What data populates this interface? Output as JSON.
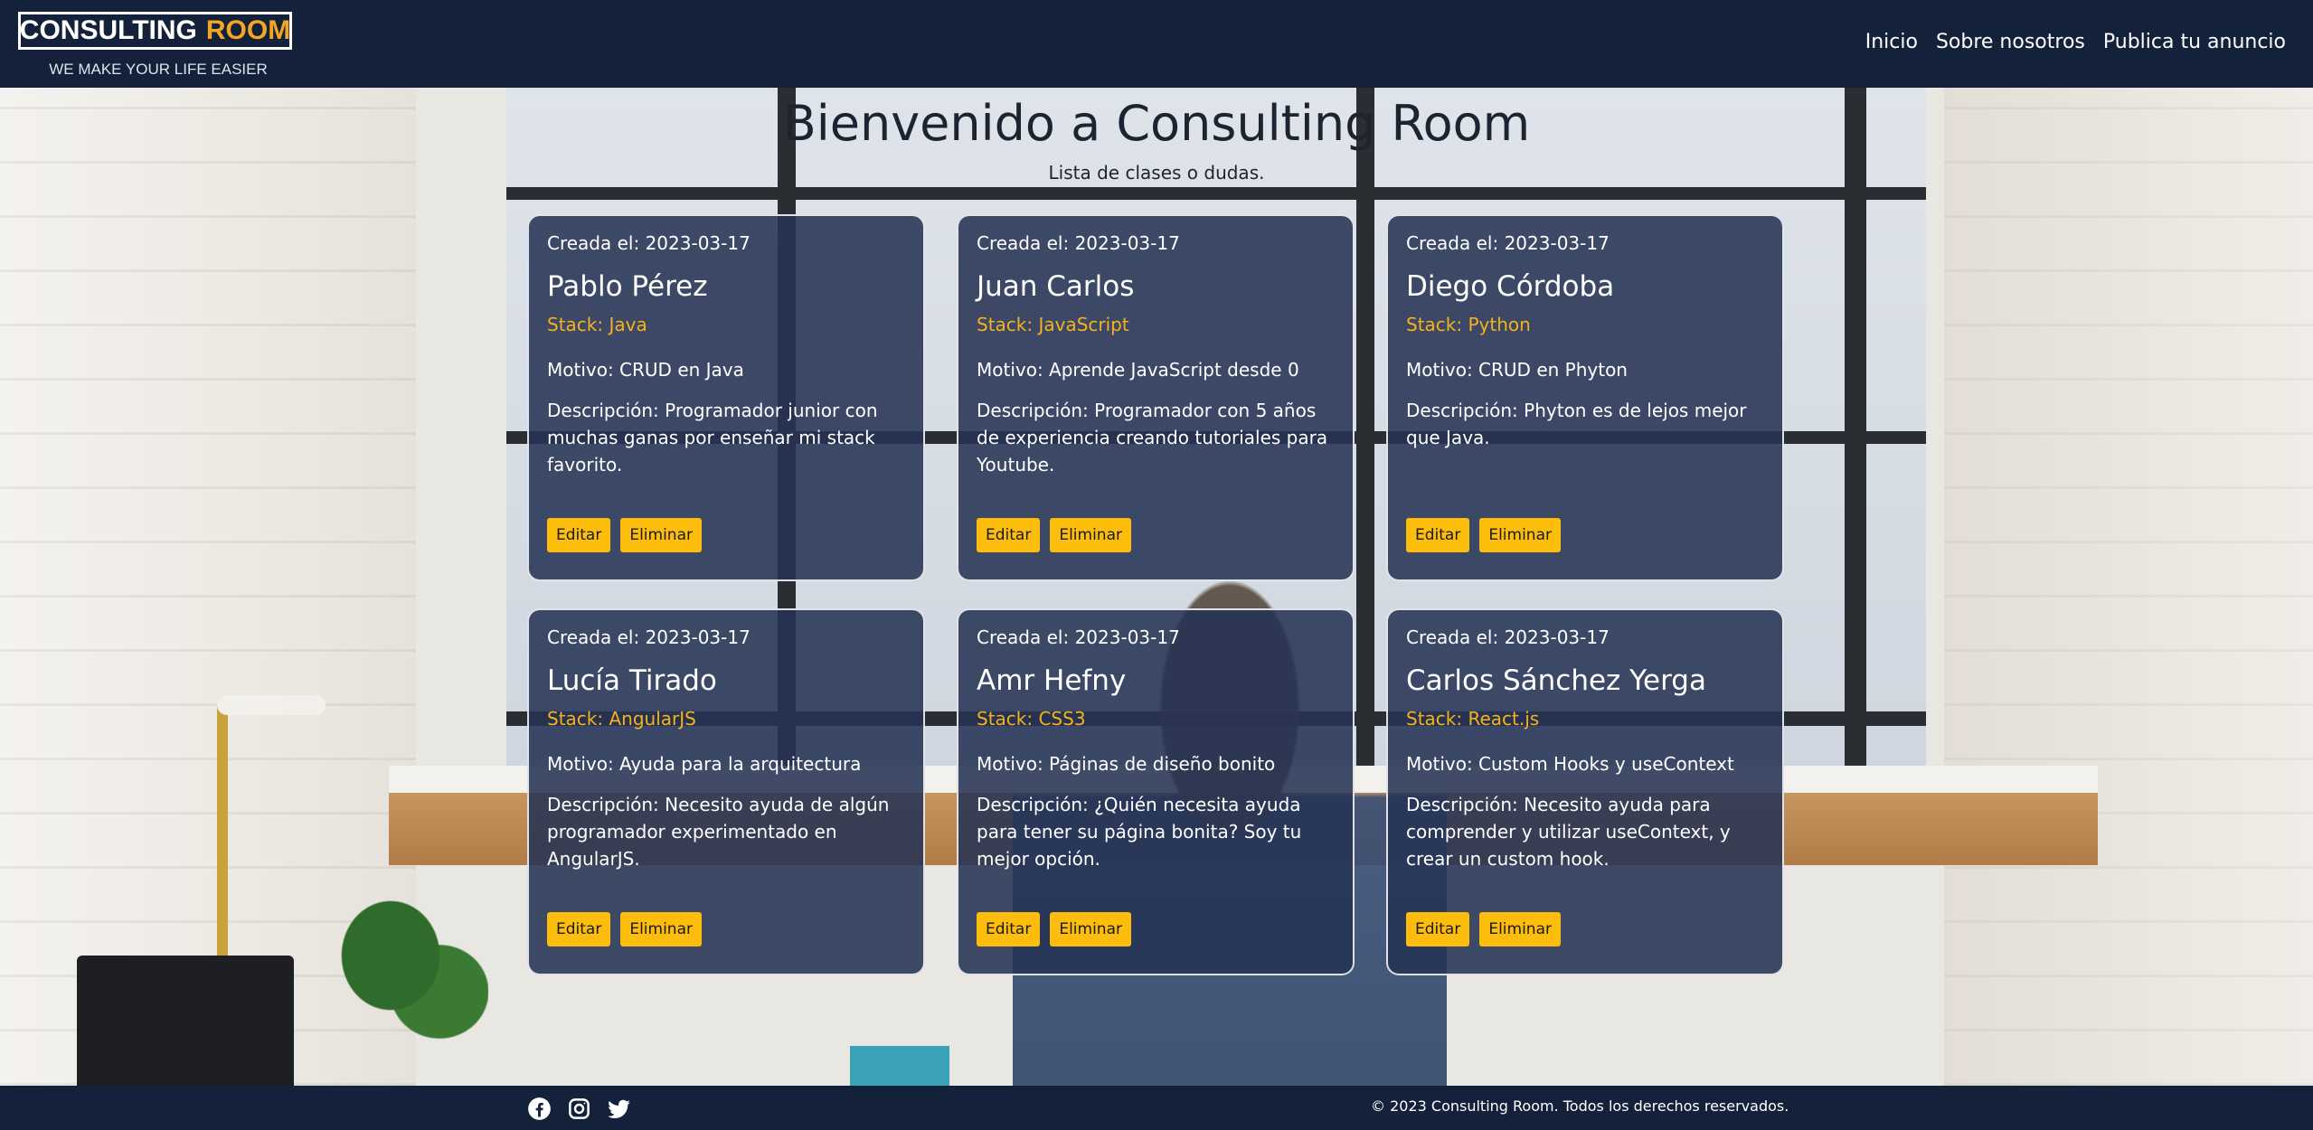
{
  "header": {
    "logo_main": "CONSULTING",
    "logo_accent": "ROOM",
    "tagline": "WE MAKE YOUR LIFE EASIER",
    "nav": [
      "Inicio",
      "Sobre nosotros",
      "Publica tu anuncio"
    ]
  },
  "main": {
    "title": "Bienvenido a Consulting Room",
    "subtitle": "Lista de clases o dudas."
  },
  "cards": [
    {
      "date": "Creada el: 2023-03-17",
      "name": "Pablo Pérez",
      "stack": "Stack: Java",
      "motivo": "Motivo: CRUD en Java",
      "descripcion": "Descripción: Programador junior con muchas ganas por enseñar mi stack favorito.",
      "edit_label": "Editar",
      "delete_label": "Eliminar"
    },
    {
      "date": "Creada el: 2023-03-17",
      "name": "Juan Carlos",
      "stack": "Stack: JavaScript",
      "motivo": "Motivo: Aprende JavaScript desde 0",
      "descripcion": "Descripción: Programador con 5 años de experiencia creando tutoriales para Youtube.",
      "edit_label": "Editar",
      "delete_label": "Eliminar"
    },
    {
      "date": "Creada el: 2023-03-17",
      "name": "Diego Córdoba",
      "stack": "Stack: Python",
      "motivo": "Motivo: CRUD en Phyton",
      "descripcion": "Descripción: Phyton es de lejos mejor que Java.",
      "edit_label": "Editar",
      "delete_label": "Eliminar"
    },
    {
      "date": "Creada el: 2023-03-17",
      "name": "Lucía Tirado",
      "stack": "Stack: AngularJS",
      "motivo": "Motivo: Ayuda para la arquitectura",
      "descripcion": "Descripción: Necesito ayuda de algún programador experimentado en AngularJS.",
      "edit_label": "Editar",
      "delete_label": "Eliminar"
    },
    {
      "date": "Creada el: 2023-03-17",
      "name": "Amr Hefny",
      "stack": "Stack: CSS3",
      "motivo": "Motivo: Páginas de diseño bonito",
      "descripcion": "Descripción: ¿Quién necesita ayuda para tener su página bonita? Soy tu mejor opción.",
      "edit_label": "Editar",
      "delete_label": "Eliminar"
    },
    {
      "date": "Creada el: 2023-03-17",
      "name": "Carlos Sánchez Yerga",
      "stack": "Stack: React.js",
      "motivo": "Motivo: Custom Hooks y useContext",
      "descripcion": "Descripción: Necesito ayuda para comprender y utilizar useContext, y crear un custom hook.",
      "edit_label": "Editar",
      "delete_label": "Eliminar"
    }
  ],
  "footer": {
    "social_icons": [
      "facebook-icon",
      "instagram-icon",
      "twitter-icon"
    ],
    "copyright": "© 2023 Consulting Room. Todos los derechos reservados."
  },
  "colors": {
    "navy": "#13213b",
    "accent": "#f5a524",
    "button": "#fcbd0c",
    "card_bg": "#253354"
  }
}
